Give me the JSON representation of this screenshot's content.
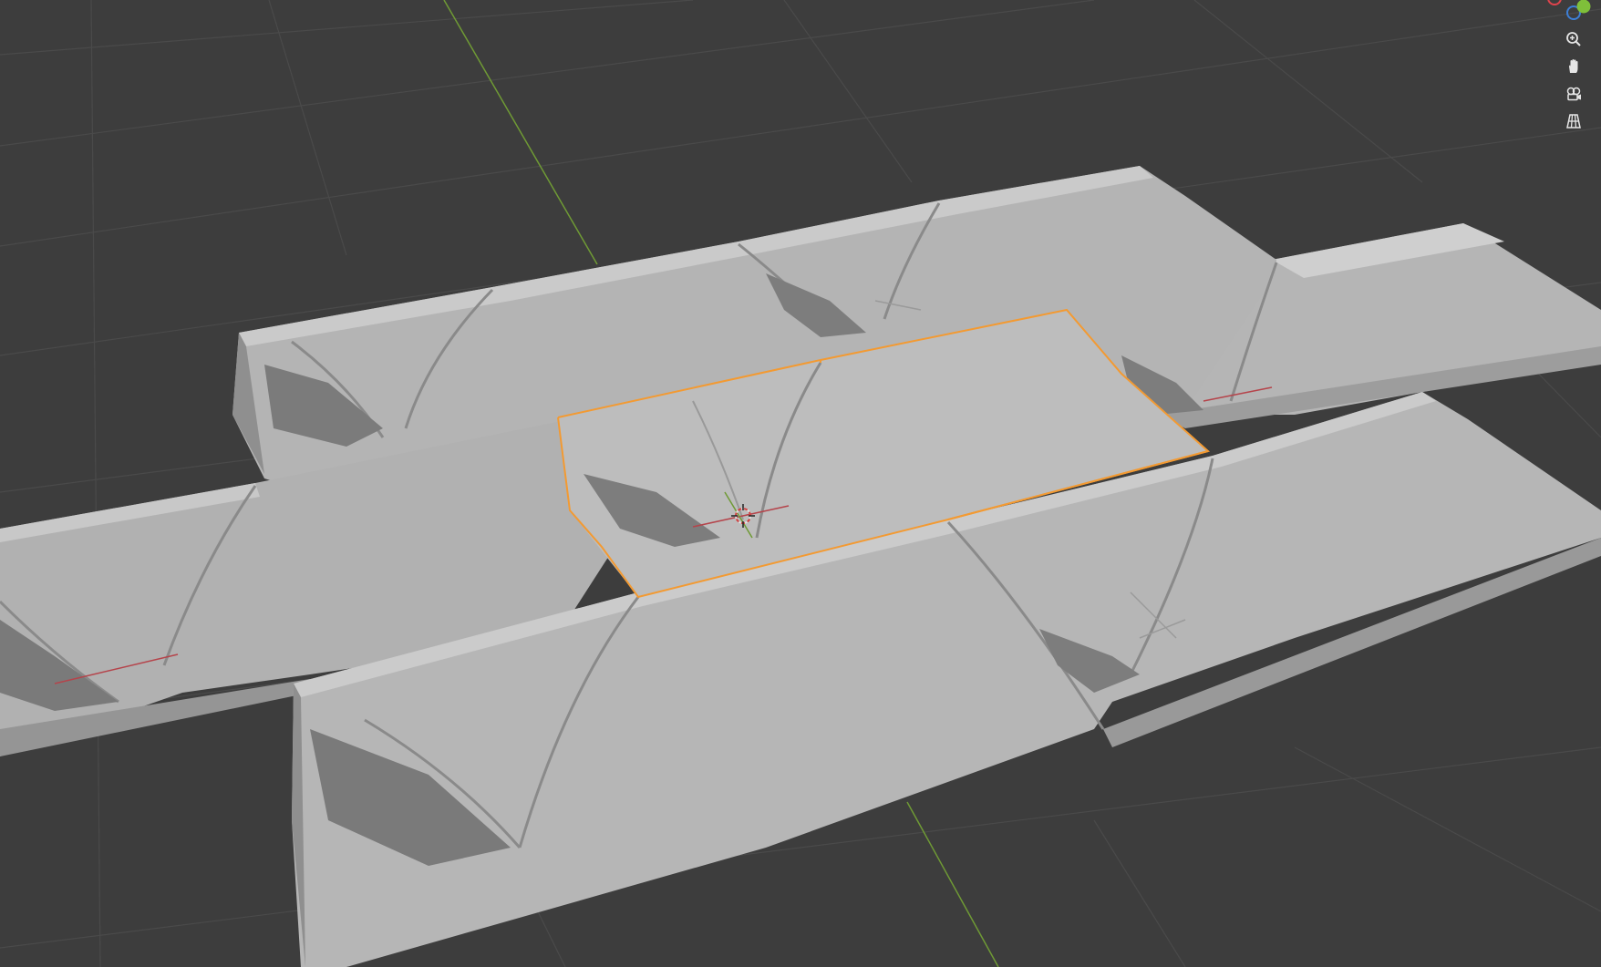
{
  "viewport": {
    "background": "#3d3d3d",
    "grid_color": "#4a4a4a",
    "x_axis_color": "#b5444b",
    "y_axis_color": "#7ba53a",
    "selection_outline_color": "#f39a32",
    "mesh_color": "#b8b8b8"
  },
  "navigation": {
    "zoom": "zoom-icon",
    "pan": "hand-icon",
    "camera": "camera-icon",
    "perspective": "grid-perspective-icon"
  },
  "gizmo": {
    "x_color": "#e0434c",
    "y_color": "#7fbf3a",
    "z_color": "#3d7fd6"
  }
}
